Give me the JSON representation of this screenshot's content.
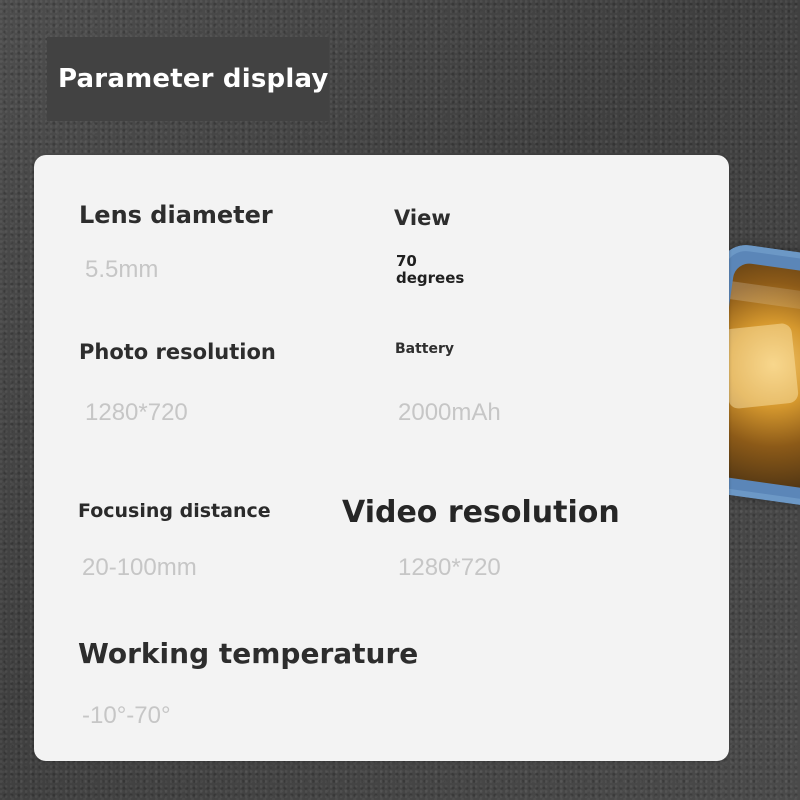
{
  "header": {
    "title": "Parameter display"
  },
  "parameters": {
    "lens_diameter": {
      "label": "Lens diameter",
      "value": "5.5mm"
    },
    "view": {
      "label": "View",
      "value": "70 degrees"
    },
    "photo_resolution": {
      "label": "Photo resolution",
      "value": "1280*720"
    },
    "battery": {
      "label": "Battery",
      "value": "2000mAh"
    },
    "focusing_distance": {
      "label": "Focusing distance",
      "value": "20-100mm"
    },
    "video_resolution": {
      "label": "Video resolution",
      "value": "1280*720"
    },
    "working_temperature": {
      "label": "Working temperature",
      "value": "-10°-70°"
    }
  }
}
